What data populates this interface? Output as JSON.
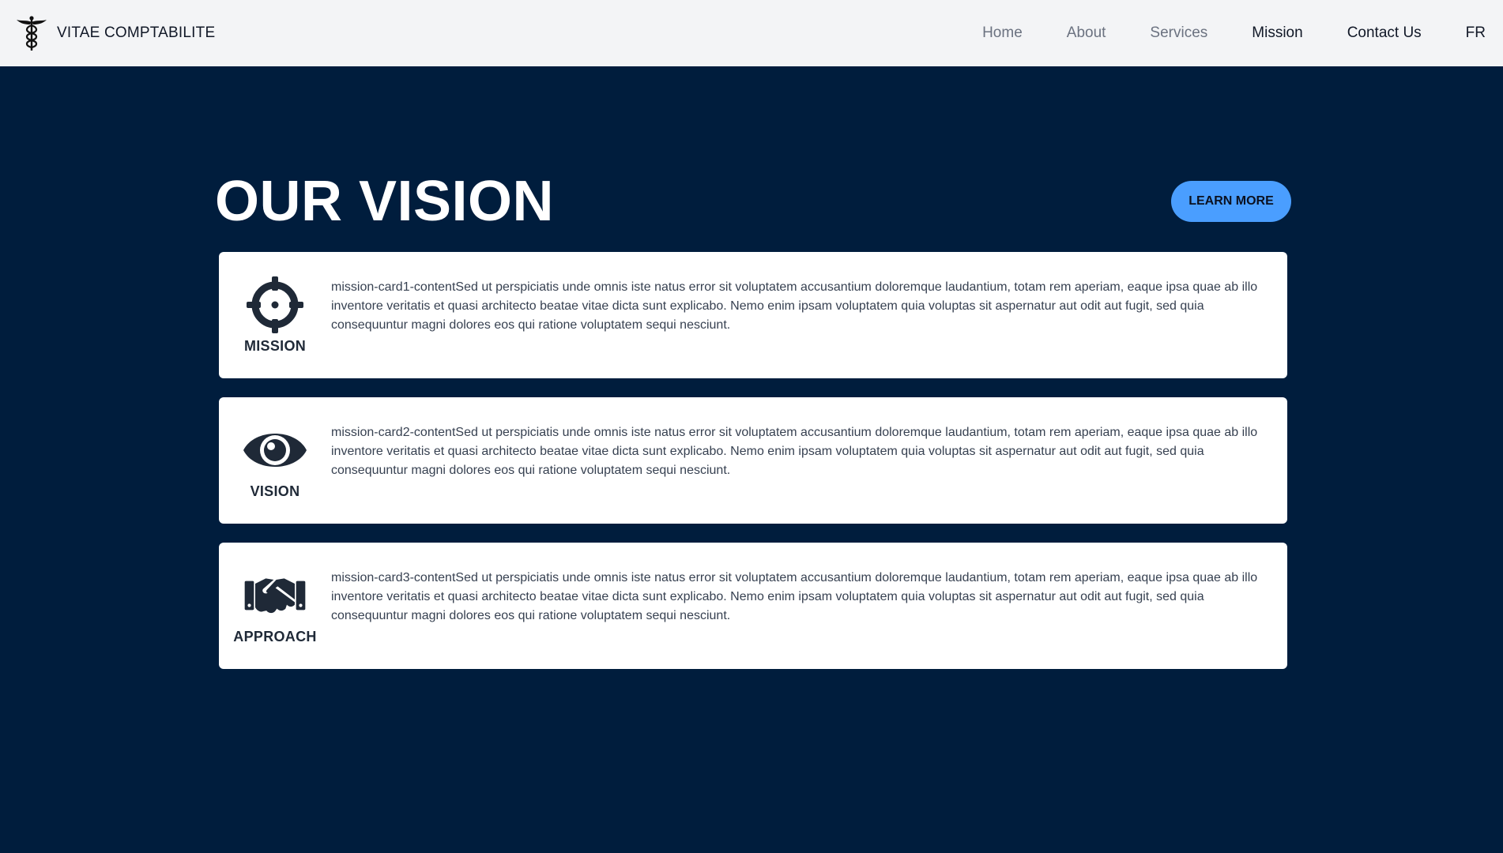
{
  "navbar": {
    "brand": "VITAE COMPTABILITE",
    "logo_icon": "caduceus-icon",
    "links": [
      {
        "label": "Home"
      },
      {
        "label": "About"
      },
      {
        "label": "Services"
      },
      {
        "label": "Mission"
      },
      {
        "label": "Contact Us"
      },
      {
        "label": "FR"
      }
    ]
  },
  "section": {
    "title": "OUR VISION",
    "button_label": "LEARN MORE"
  },
  "cards": [
    {
      "label": "MISSION",
      "icon": "crosshair-icon",
      "content": "mission-card1-contentSed ut perspiciatis unde omnis iste natus error sit voluptatem accusantium doloremque laudantium, totam rem aperiam, eaque ipsa quae ab illo inventore veritatis et quasi architecto beatae vitae dicta sunt explicabo. Nemo enim ipsam voluptatem quia voluptas sit aspernatur aut odit aut fugit, sed quia consequuntur magni dolores eos qui ratione voluptatem sequi nesciunt."
    },
    {
      "label": "VISION",
      "icon": "eye-icon",
      "content": "mission-card2-contentSed ut perspiciatis unde omnis iste natus error sit voluptatem accusantium doloremque laudantium, totam rem aperiam, eaque ipsa quae ab illo inventore veritatis et quasi architecto beatae vitae dicta sunt explicabo. Nemo enim ipsam voluptatem quia voluptas sit aspernatur aut odit aut fugit, sed quia consequuntur magni dolores eos qui ratione voluptatem sequi nesciunt."
    },
    {
      "label": "APPROACH",
      "icon": "handshake-icon",
      "content": "mission-card3-contentSed ut perspiciatis unde omnis iste natus error sit voluptatem accusantium doloremque laudantium, totam rem aperiam, eaque ipsa quae ab illo inventore veritatis et quasi architecto beatae vitae dicta sunt explicabo. Nemo enim ipsam voluptatem quia voluptas sit aspernatur aut odit aut fugit, sed quia consequuntur magni dolores eos qui ratione voluptatem sequi nesciunt."
    }
  ],
  "colors": {
    "background": "#001d3d",
    "navbar": "#f3f4f6",
    "accent": "#4a9eff",
    "icon": "#1f2937"
  }
}
